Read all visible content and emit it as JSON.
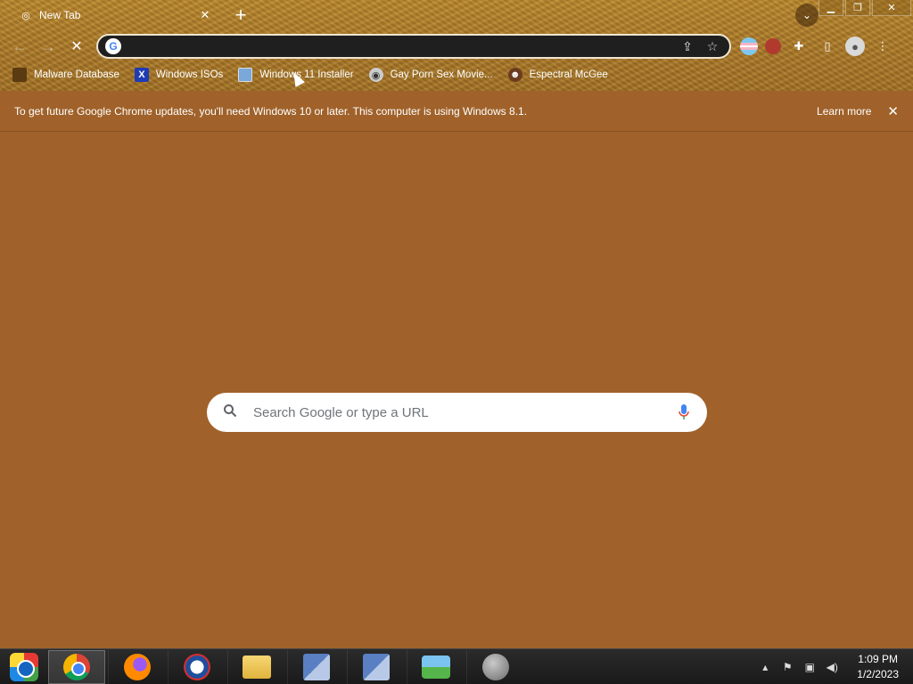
{
  "tab": {
    "title": "New Tab",
    "favicon": "chrome-icon"
  },
  "toolbar": {
    "omnibox_value": "",
    "search_engine": "G"
  },
  "bookmarks": [
    {
      "label": "Malware Database",
      "icon": "bookmark-icon"
    },
    {
      "label": "Windows ISOs",
      "icon": "x-logo-icon"
    },
    {
      "label": "Windows 11 Installer",
      "icon": "image-icon"
    },
    {
      "label": "Gay Porn Sex Movie...",
      "icon": "disc-icon"
    },
    {
      "label": "Espectral McGee",
      "icon": "face-icon"
    }
  ],
  "infobar": {
    "message": "To get future Google Chrome updates, you'll need Windows 10 or later. This computer is using Windows 8.1.",
    "learn_more": "Learn more"
  },
  "ntp": {
    "search_placeholder": "Search Google or type a URL"
  },
  "taskbar": {
    "apps": [
      "start-orb",
      "chrome",
      "firefox",
      "obama-app",
      "file-explorer",
      "setup-1",
      "setup-2",
      "messenger",
      "flash"
    ],
    "time": "1:09 PM",
    "date": "1/2/2023"
  },
  "colors": {
    "background": "#a0622a",
    "omnibox": "#1f1f1f",
    "taskbar": "#1a1a1a"
  }
}
